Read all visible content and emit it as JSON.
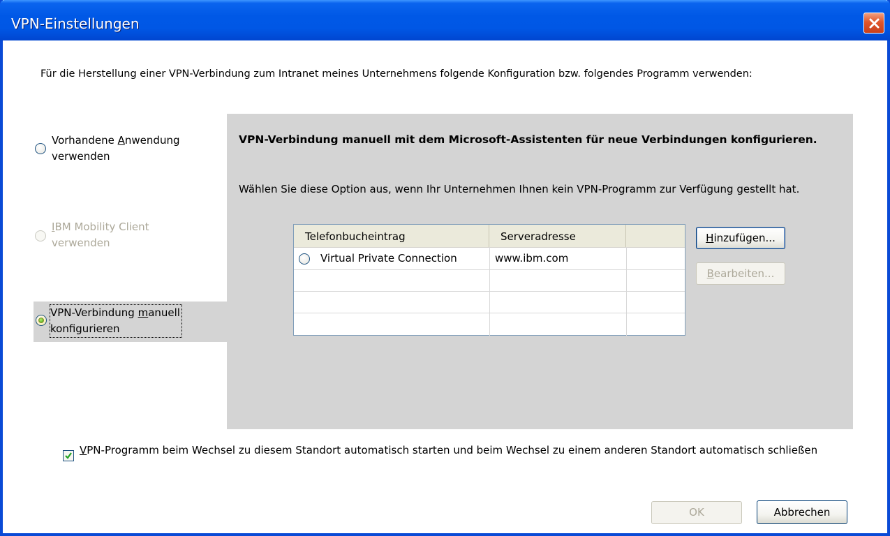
{
  "window": {
    "title": "VPN-Einstellungen",
    "close_icon": "close-icon"
  },
  "intro_text": "Für die Herstellung einer VPN-Verbindung zum Intranet meines Unternehmens folgende Konfiguration bzw. folgendes Programm verwenden:",
  "options": [
    {
      "line1_pre": "Vorhandene ",
      "line1_mnemonic": "A",
      "line1_post": "nwendung",
      "line2": "verwenden",
      "selected": false,
      "enabled": true
    },
    {
      "line1_pre": "",
      "line1_mnemonic": "I",
      "line1_post": "BM Mobility Client",
      "line2": "verwenden",
      "selected": false,
      "enabled": false
    },
    {
      "line1_pre": "VPN-Verbindung ",
      "line1_mnemonic": "m",
      "line1_post": "anuell",
      "line2": "konfigurieren",
      "selected": true,
      "enabled": true
    }
  ],
  "panel": {
    "title": "VPN-Verbindung manuell mit dem Microsoft-Assistenten für neue Verbindungen konfigurieren.",
    "description": "Wählen Sie diese Option aus, wenn Ihr Unternehmen Ihnen kein VPN-Programm zur Verfügung gestellt hat."
  },
  "table": {
    "columns": [
      "Telefonbucheintrag",
      "Serveradresse",
      ""
    ],
    "rows": [
      {
        "name": "Virtual Private Connection",
        "server": "www.ibm.com",
        "selected": false
      }
    ]
  },
  "buttons": {
    "add": {
      "pre": "",
      "mnemonic": "H",
      "post": "inzufügen...",
      "enabled": true
    },
    "edit": {
      "pre": "",
      "mnemonic": "B",
      "post": "earbeiten...",
      "enabled": false
    },
    "ok": {
      "label": "OK",
      "enabled": false
    },
    "cancel": {
      "label": "Abbrechen",
      "enabled": true
    }
  },
  "auto_start": {
    "checked": true,
    "mnemonic": "V",
    "label_rest": "PN-Programm beim Wechsel zu diesem Standort automatisch starten und beim Wechsel zu einem anderen Standort automatisch schließen"
  },
  "colors": {
    "titlebar": "#0058e6",
    "panel_bg": "#d4d4d4",
    "close_button": "#e0552a",
    "disabled_text": "#aca899"
  }
}
